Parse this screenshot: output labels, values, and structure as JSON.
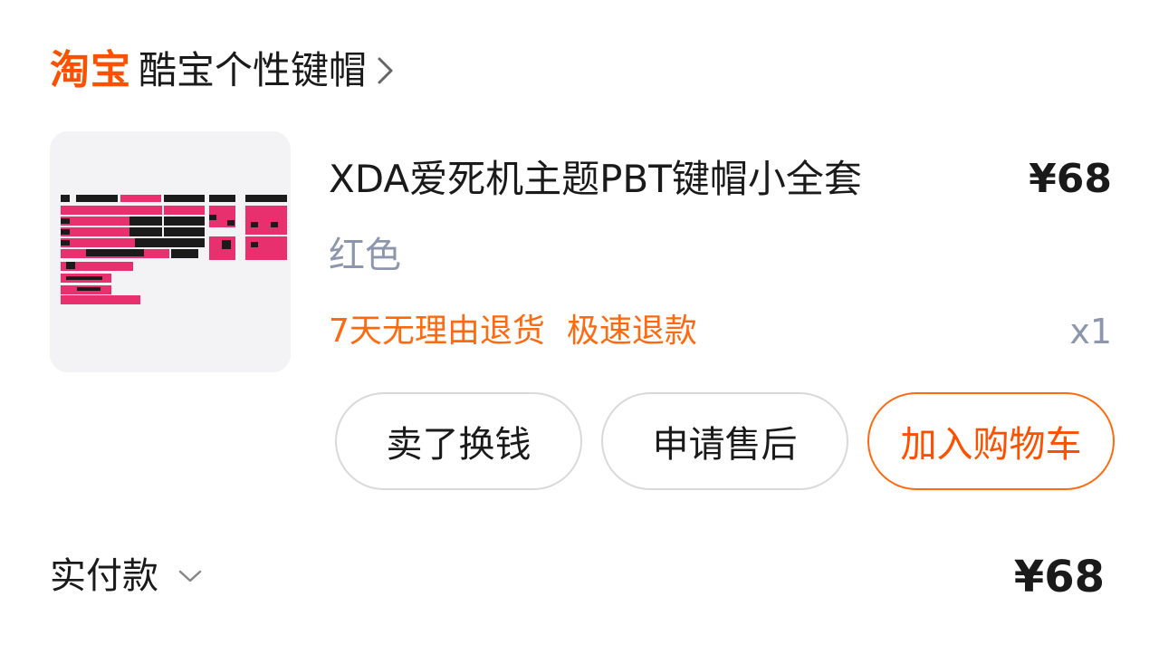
{
  "shop": {
    "logo_text": "淘宝",
    "name": "酷宝个性键帽",
    "chevron_icon": "chevron-right-icon"
  },
  "product": {
    "title": "XDA爱死机主题PBT键帽小全套",
    "price": "¥68",
    "variant": "红色",
    "services": [
      "7天无理由退货",
      "极速退款"
    ],
    "quantity": "x1",
    "image_icon": "keyboard-keycaps-image",
    "accent_color": "#ff5000",
    "keycap_pink": "#e8306f",
    "keycap_black": "#1b1b1b"
  },
  "actions": {
    "sell_label": "卖了换钱",
    "after_sale_label": "申请售后",
    "cart_label": "加入购物车"
  },
  "payment": {
    "label": "实付款",
    "chevron_icon": "chevron-down-icon",
    "amount": "¥68"
  }
}
